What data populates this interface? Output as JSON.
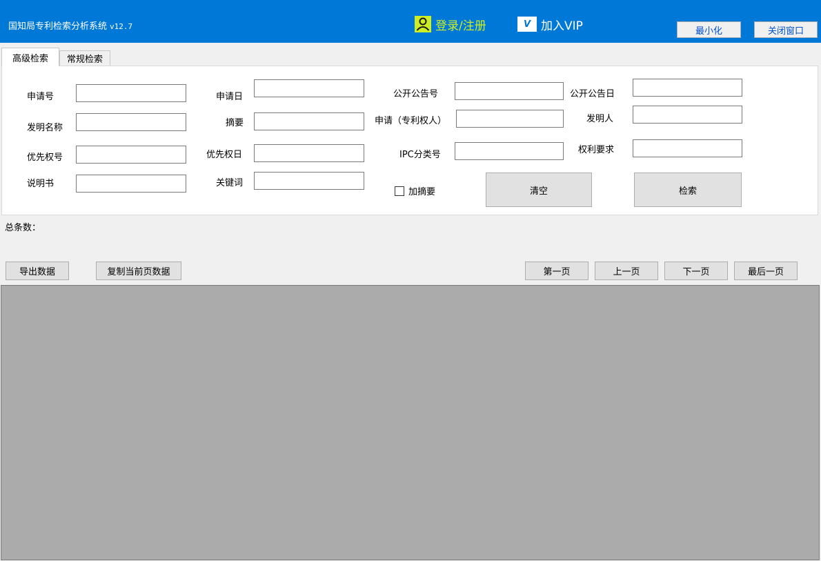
{
  "window": {
    "title": "国知局专利检索分析系统",
    "version": "v12.7",
    "login_label": "登录/注册",
    "vip_icon_text": "V",
    "vip_label": "加入VIP",
    "minimize_label": "最小化",
    "close_label": "关闭窗口"
  },
  "tabs": [
    {
      "label": "高级检索",
      "active": true
    },
    {
      "label": "常规检索",
      "active": false
    }
  ],
  "form": {
    "application_no": {
      "label": "申请号",
      "value": ""
    },
    "application_date": {
      "label": "申请日",
      "value": ""
    },
    "publication_no": {
      "label": "公开公告号",
      "value": ""
    },
    "publication_date": {
      "label": "公开公告日",
      "value": ""
    },
    "invention_name": {
      "label": "发明名称",
      "value": ""
    },
    "abstract": {
      "label": "摘要",
      "value": ""
    },
    "applicant": {
      "label": "申请（专利权人）",
      "value": ""
    },
    "inventor": {
      "label": "发明人",
      "value": ""
    },
    "priority_no": {
      "label": "优先权号",
      "value": ""
    },
    "priority_date": {
      "label": "优先权日",
      "value": ""
    },
    "ipc": {
      "label": "IPC分类号",
      "value": ""
    },
    "claims": {
      "label": "权利要求",
      "value": ""
    },
    "description": {
      "label": "说明书",
      "value": ""
    },
    "keywords": {
      "label": "关键词",
      "value": ""
    },
    "add_abstract": {
      "label": "加摘要",
      "checked": false
    },
    "clear_label": "清空",
    "search_label": "检索"
  },
  "results": {
    "total_label": "总条数："
  },
  "toolbar": {
    "export_label": "导出数据",
    "copy_label": "复制当前页数据",
    "first_label": "第一页",
    "prev_label": "上一页",
    "next_label": "下一页",
    "last_label": "最后一页"
  },
  "colors": {
    "titlebar": "#0078d7",
    "login_accent": "#ccee22",
    "results_bg": "#ababab"
  }
}
